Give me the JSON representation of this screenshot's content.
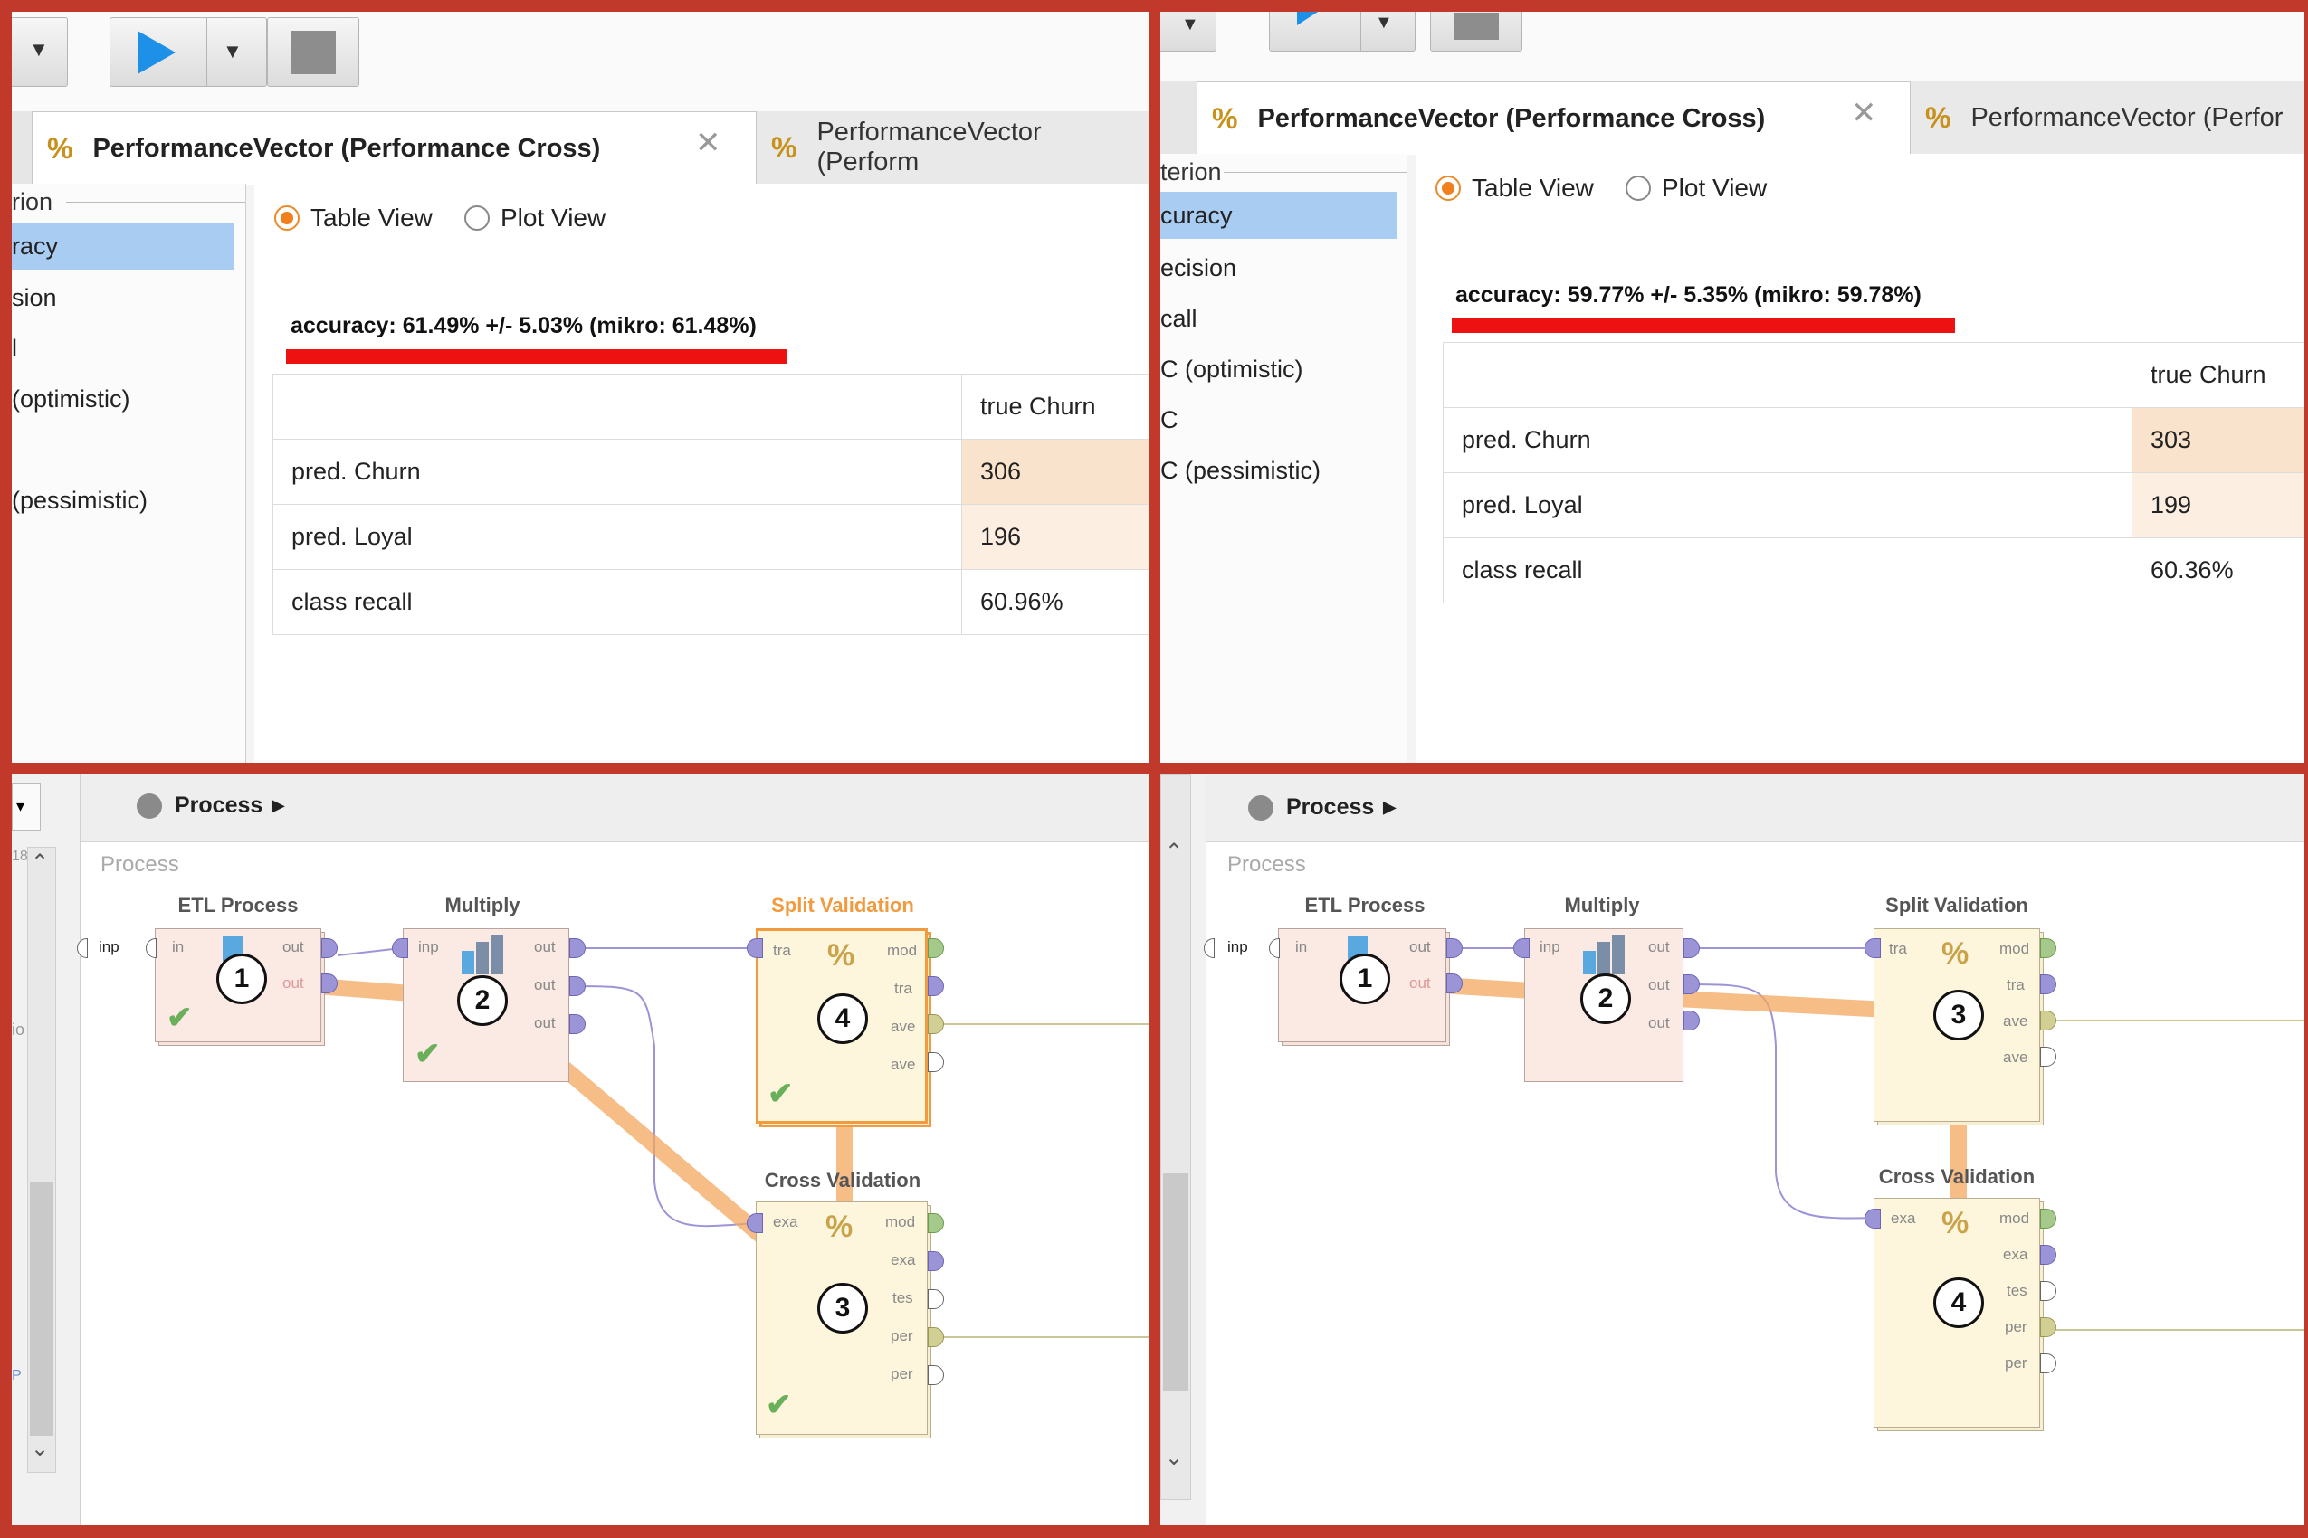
{
  "q1": {
    "tab_active": "PerformanceVector (Performance Cross)",
    "tab_inactive": "PerformanceVector (Perform",
    "sidebar_header": "rion",
    "sidebar_items": [
      "racy",
      "sion",
      "l",
      "(optimistic)",
      "",
      "(pessimistic)"
    ],
    "view_table": "Table View",
    "view_plot": "Plot View",
    "accuracy": "accuracy: 61.49% +/- 5.03% (mikro: 61.48%)",
    "col_header": "true Churn",
    "rows": [
      {
        "label": "pred. Churn",
        "value": "306"
      },
      {
        "label": "pred. Loyal",
        "value": "196"
      },
      {
        "label": "class recall",
        "value": "60.96%"
      }
    ]
  },
  "q2": {
    "tab_active": "PerformanceVector (Performance Cross)",
    "tab_inactive": "PerformanceVector (Perfor",
    "sidebar_header": "terion",
    "sidebar_items": [
      "curacy",
      "ecision",
      "call",
      "C (optimistic)",
      "C",
      "C (pessimistic)"
    ],
    "view_table": "Table View",
    "view_plot": "Plot View",
    "accuracy": "accuracy: 59.77% +/- 5.35% (mikro: 59.78%)",
    "col_header": "true Churn",
    "rows": [
      {
        "label": "pred. Churn",
        "value": "303"
      },
      {
        "label": "pred. Loyal",
        "value": "199"
      },
      {
        "label": "class recall",
        "value": "60.36%"
      }
    ]
  },
  "q3": {
    "breadcrumb": "Process",
    "canvas_label": "Process",
    "input_port": "inp",
    "ops": {
      "etl": "ETL Process",
      "multiply": "Multiply",
      "split": "Split Validation",
      "cross": "Cross Validation"
    },
    "numbers": {
      "etl": "1",
      "multiply": "2",
      "split": "4",
      "cross": "3"
    },
    "side_frag": "18",
    "side_frag2": "io",
    "side_frag3": "P"
  },
  "q4": {
    "breadcrumb": "Process",
    "canvas_label": "Process",
    "input_port": "inp",
    "ops": {
      "etl": "ETL Process",
      "multiply": "Multiply",
      "split": "Split Validation",
      "cross": "Cross Validation"
    },
    "numbers": {
      "etl": "1",
      "multiply": "2",
      "split": "3",
      "cross": "4"
    }
  },
  "ports": {
    "in": "in",
    "out": "out",
    "inp": "inp",
    "tra": "tra",
    "mod": "mod",
    "ave": "ave",
    "exa": "exa",
    "tes": "tes",
    "per": "per"
  },
  "icons": [
    "play-icon",
    "dropdown-arrow-icon",
    "stop-icon",
    "percent-icon",
    "close-icon",
    "checkmark-icon",
    "chevron-right-icon",
    "scroll-up-icon",
    "scroll-down-icon"
  ]
}
